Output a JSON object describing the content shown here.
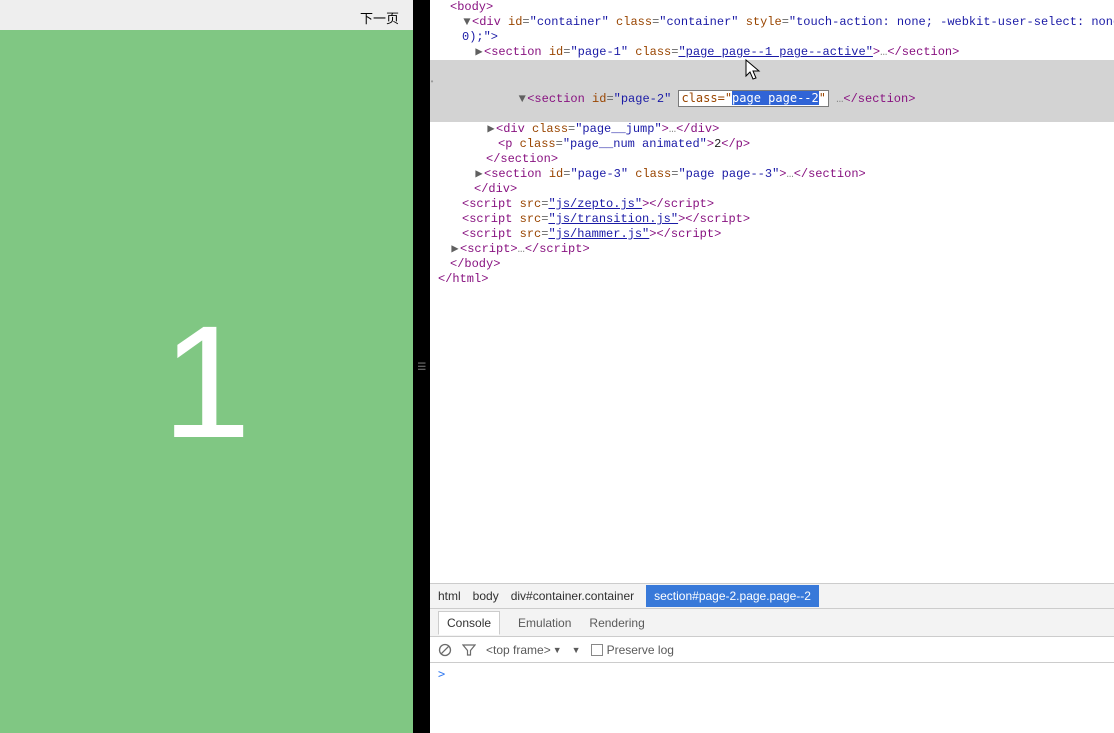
{
  "preview": {
    "nav_label": "下一页",
    "big_number": "1"
  },
  "tree": {
    "body_open": "<body>",
    "container": {
      "open_prefix": "<div id=",
      "id": "\"container\"",
      "class_label": " class=",
      "class_val": "\"container\"",
      "style_label": " style=",
      "style_val": "\"touch-action: none; -webkit-user-select: none; -webki",
      "open_suffix_line2": "0);\">"
    },
    "page1": {
      "prefix": "<section id=",
      "id": "\"page-1\"",
      "class_label": " class=",
      "class_val": "\"page page--1 page--active\"",
      "close_inline": ">…</section>"
    },
    "page2": {
      "prefix": "<section id=",
      "id": "\"page-2\"",
      "class_attr_label": "class=\"",
      "class_attr_val": "page page--2",
      "close_inline": " …</section>",
      "jump": {
        "prefix": "<div class=",
        "val": "\"page__jump\"",
        "close": ">…</div>"
      },
      "pnum": {
        "prefix": "<p class=",
        "val": "\"page__num animated\"",
        "text": ">2</p>"
      },
      "endsection": "</section>"
    },
    "page3": {
      "prefix": "<section id=",
      "id": "\"page-3\"",
      "class_label": " class=",
      "class_val": "\"page page--3\"",
      "close_inline": ">…</section>"
    },
    "enddiv": "</div>",
    "scripts": {
      "prefix": "<script src=",
      "s1": "\"js/zepto.js\"",
      "s2": "\"js/transition.js\"",
      "s3": "\"js/hammer.js\"",
      "close": "></scr"
    },
    "inline_script": "<script>…</scr",
    "endbody": "</body>",
    "endhtml": "</html>"
  },
  "breadcrumb": {
    "c0": "html",
    "c1": "body",
    "c2": "div#container.container",
    "c3": "section#page-2.page.page--2"
  },
  "drawer": {
    "t0": "Console",
    "t1": "Emulation",
    "t2": "Rendering"
  },
  "toolbar": {
    "frame": "<top frame>",
    "preserve": "Preserve log"
  },
  "console": {
    "prompt": ">"
  }
}
